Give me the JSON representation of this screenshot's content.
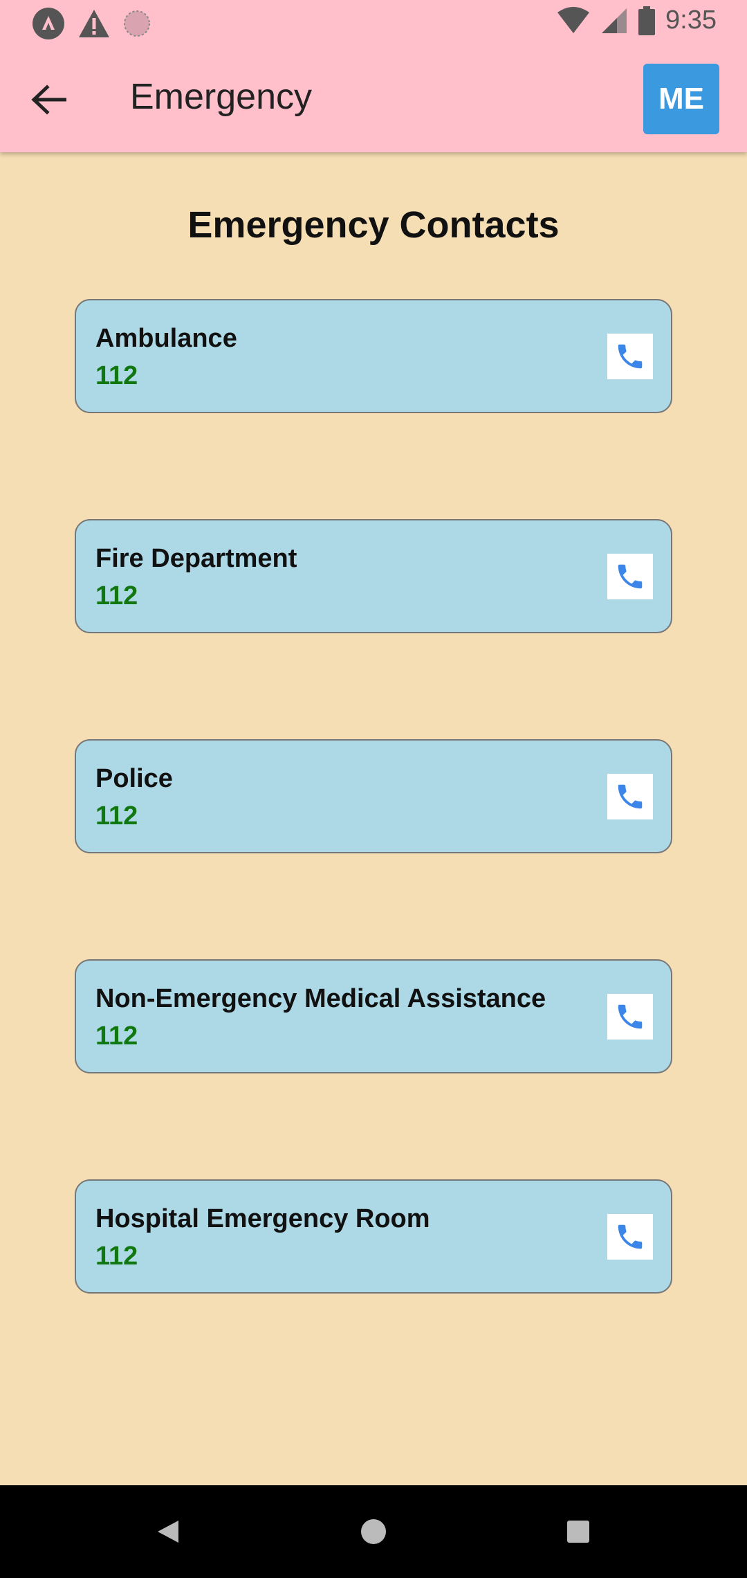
{
  "status_bar": {
    "time": "9:35",
    "icons": [
      "app-notification-icon",
      "warning-icon",
      "loading-icon",
      "wifi-icon",
      "cell-signal-icon",
      "battery-icon"
    ]
  },
  "app_bar": {
    "title": "Emergency",
    "profile_label": "ME",
    "profile_color": "#3b99e0"
  },
  "page": {
    "heading": "Emergency Contacts"
  },
  "contacts": [
    {
      "name": "Ambulance",
      "number": "112"
    },
    {
      "name": "Fire Department",
      "number": "112"
    },
    {
      "name": "Police",
      "number": "112"
    },
    {
      "name": "Non-Emergency Medical Assistance",
      "number": "112"
    },
    {
      "name": "Hospital Emergency Room",
      "number": "112"
    }
  ],
  "colors": {
    "app_bar": "#ffc0cb",
    "background": "#f5deb3",
    "card": "#add8e6",
    "number": "#117711",
    "phone_icon": "#3b86e8"
  },
  "navigation": [
    "back-triangle-icon",
    "home-circle-icon",
    "recents-square-icon"
  ]
}
